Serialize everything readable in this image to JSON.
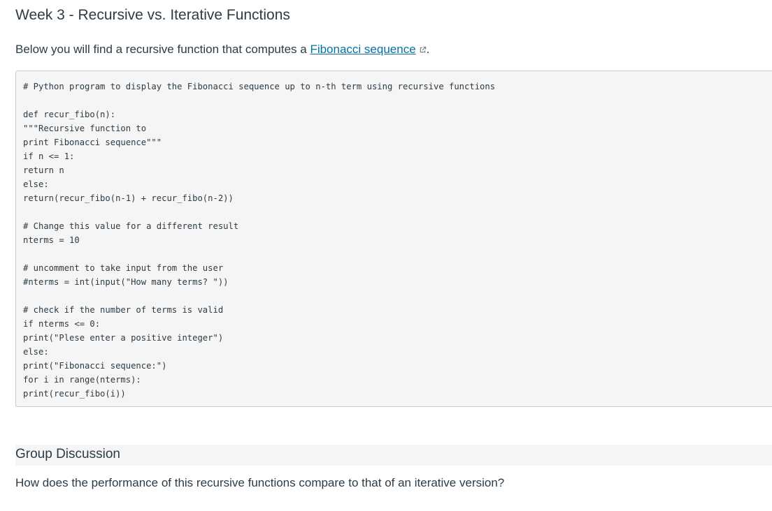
{
  "page": {
    "title": "Week 3 - Recursive vs. Iterative Functions"
  },
  "intro": {
    "text_before": "Below you will find a recursive function that computes a ",
    "link_text": "Fibonacci sequence",
    "link_icon": "external-link-icon",
    "text_after": "."
  },
  "code": {
    "lines": [
      "# Python program to display the Fibonacci sequence up to n-th term using recursive functions",
      "",
      "def recur_fibo(n):",
      "\"\"\"Recursive function to",
      "print Fibonacci sequence\"\"\"",
      "if n <= 1:",
      "return n",
      "else:",
      "return(recur_fibo(n-1) + recur_fibo(n-2))",
      "",
      "# Change this value for a different result",
      "nterms = 10",
      "",
      "# uncomment to take input from the user",
      "#nterms = int(input(\"How many terms? \"))",
      "",
      "# check if the number of terms is valid",
      "if nterms <= 0:",
      "print(\"Plese enter a positive integer\")",
      "else:",
      "print(\"Fibonacci sequence:\")",
      "for i in range(nterms):",
      "print(recur_fibo(i))"
    ]
  },
  "discussion": {
    "heading": "Group Discussion",
    "question": "How does the performance of this recursive functions compare to that of an iterative version?"
  },
  "colors": {
    "text": "#2d3b45",
    "link": "#0770a3",
    "code_bg": "#f5f5f5",
    "code_border": "#c7cdd1"
  }
}
